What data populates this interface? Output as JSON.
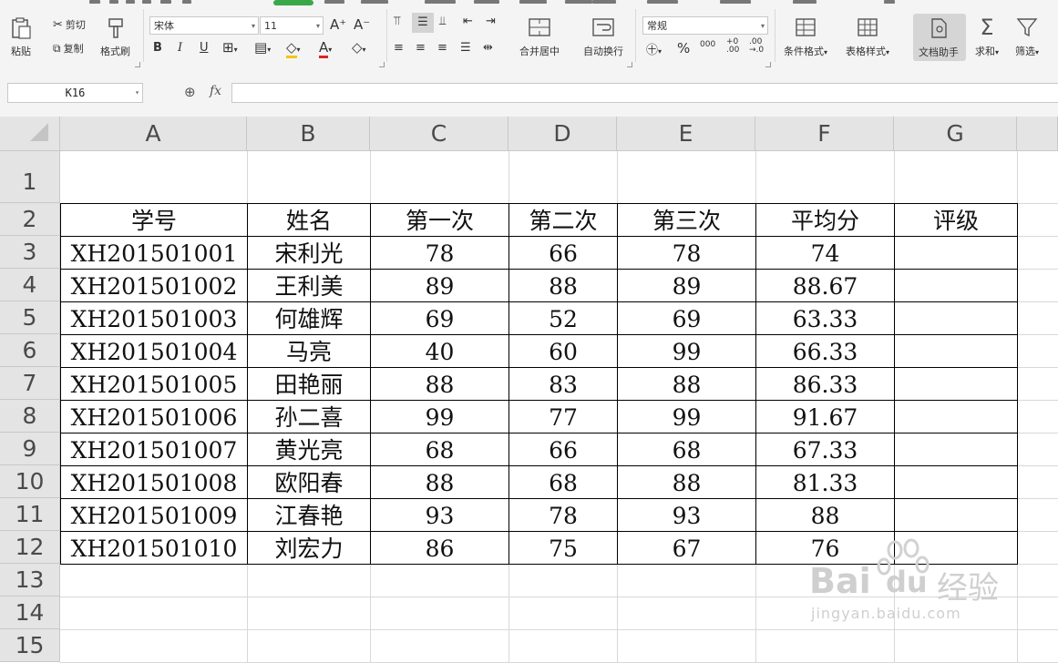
{
  "ribbon": {
    "clipboard": {
      "paste": "粘贴",
      "cut": "剪切",
      "copy": "复制",
      "format_painter": "格式刷"
    },
    "font": {
      "name": "宋体",
      "size": "11",
      "bold": "B",
      "italic": "I",
      "underline": "U",
      "font_color": "A"
    },
    "alignment": {
      "merge_center": "合并居中",
      "wrap_text": "自动换行"
    },
    "number": {
      "format": "常规",
      "percent": "%",
      "thousands": "000",
      "inc_decimal": "+0\n.00",
      "dec_decimal": ".00\n→.0"
    },
    "styles": {
      "conditional_format": "条件格式",
      "table_style": "表格样式"
    },
    "tools": {
      "doc_helper": "文档助手",
      "sum": "求和",
      "filter": "筛选"
    }
  },
  "formula_bar": {
    "name_box": "K16",
    "fx": "fx",
    "value": ""
  },
  "columns": [
    "A",
    "B",
    "C",
    "D",
    "E",
    "F",
    "G"
  ],
  "rows": [
    "1",
    "2",
    "3",
    "4",
    "5",
    "6",
    "7",
    "8",
    "9",
    "10",
    "11",
    "12",
    "13",
    "14",
    "15"
  ],
  "table": {
    "headers": [
      "学号",
      "姓名",
      "第一次",
      "第二次",
      "第三次",
      "平均分",
      "评级"
    ],
    "rows": [
      [
        "XH201501001",
        "宋利光",
        "78",
        "66",
        "78",
        "74",
        ""
      ],
      [
        "XH201501002",
        "王利美",
        "89",
        "88",
        "89",
        "88.67",
        ""
      ],
      [
        "XH201501003",
        "何雄辉",
        "69",
        "52",
        "69",
        "63.33",
        ""
      ],
      [
        "XH201501004",
        "马亮",
        "40",
        "60",
        "99",
        "66.33",
        ""
      ],
      [
        "XH201501005",
        "田艳丽",
        "88",
        "83",
        "88",
        "86.33",
        ""
      ],
      [
        "XH201501006",
        "孙二喜",
        "99",
        "77",
        "99",
        "91.67",
        ""
      ],
      [
        "XH201501007",
        "黄光亮",
        "68",
        "66",
        "68",
        "67.33",
        ""
      ],
      [
        "XH201501008",
        "欧阳春",
        "88",
        "68",
        "88",
        "81.33",
        ""
      ],
      [
        "XH201501009",
        "江春艳",
        "93",
        "78",
        "93",
        "88",
        ""
      ],
      [
        "XH201501010",
        "刘宏力",
        "86",
        "75",
        "67",
        "76",
        ""
      ]
    ]
  },
  "watermark": {
    "brand": "Bai",
    "brand2": "du",
    "cn": "经验",
    "url": "jingyan.baidu.com"
  },
  "colors": {
    "accent_tab": "#3aa84a",
    "header_bg": "#e4e4e4",
    "grid_line": "#d8d8d8",
    "border": "#000000"
  }
}
